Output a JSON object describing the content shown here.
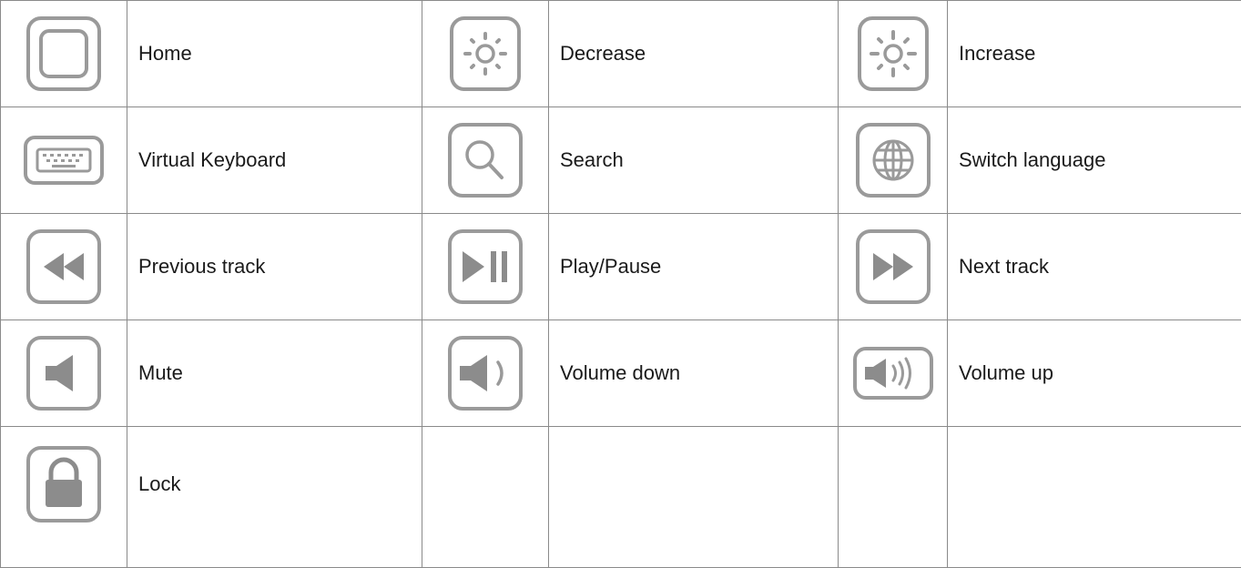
{
  "rows": [
    [
      {
        "icon": "home-icon",
        "label": "Home"
      },
      {
        "icon": "brightness-decrease-icon",
        "label": "Decrease"
      },
      {
        "icon": "brightness-increase-icon",
        "label": "Increase"
      }
    ],
    [
      {
        "icon": "keyboard-icon",
        "label": "Virtual Keyboard"
      },
      {
        "icon": "search-icon",
        "label": "Search"
      },
      {
        "icon": "globe-icon",
        "label": "Switch language"
      }
    ],
    [
      {
        "icon": "previous-track-icon",
        "label": "Previous track"
      },
      {
        "icon": "play-pause-icon",
        "label": "Play/Pause"
      },
      {
        "icon": "next-track-icon",
        "label": "Next track"
      }
    ],
    [
      {
        "icon": "mute-icon",
        "label": "Mute"
      },
      {
        "icon": "volume-down-icon",
        "label": "Volume down"
      },
      {
        "icon": "volume-up-icon",
        "label": "Volume up"
      }
    ],
    [
      {
        "icon": "lock-icon",
        "label": "Lock"
      }
    ]
  ],
  "colors": {
    "icon_stroke": "#9a9a9a",
    "icon_fill": "#8c8c8c",
    "border": "#8a8a8a",
    "text": "#1a1a1a"
  }
}
